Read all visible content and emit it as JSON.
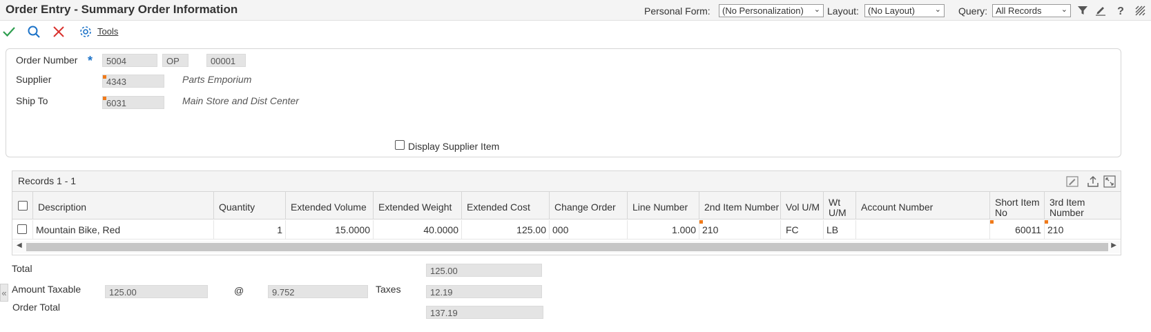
{
  "header": {
    "title": "Order Entry - Summary Order Information",
    "personal_form_label": "Personal Form:",
    "personal_form_value": "(No Personalization)",
    "layout_label": "Layout:",
    "layout_value": "(No Layout)",
    "query_label": "Query:",
    "query_value": "All Records",
    "icons": [
      "filter-icon",
      "edit-icon",
      "help-icon",
      "stripes-icon"
    ]
  },
  "toolbar": {
    "tools_label": "Tools",
    "icons": [
      "checkmark-icon",
      "search-icon",
      "close-icon",
      "gear-icon"
    ]
  },
  "form": {
    "order_number_label": "Order Number",
    "order_number": "5004",
    "order_type": "OP",
    "order_company": "00001",
    "supplier_label": "Supplier",
    "supplier": "4343",
    "supplier_name": "Parts Emporium",
    "ship_to_label": "Ship To",
    "ship_to": "6031",
    "ship_to_name": "Main Store and Dist Center",
    "display_supplier_item_label": "Display Supplier Item"
  },
  "grid": {
    "records_label": "Records 1 - 1",
    "columns": [
      "Description",
      "Quantity",
      "Extended Volume",
      "Extended Weight",
      "Extended Cost",
      "Change Order",
      "Line Number",
      "2nd Item Number",
      "Vol U/M",
      "Wt U/M",
      "Account Number",
      "Short Item No",
      "3rd Item Number"
    ],
    "rows": [
      {
        "description": "Mountain Bike, Red",
        "quantity": "1",
        "extended_volume": "15.0000",
        "extended_weight": "40.0000",
        "extended_cost": "125.00",
        "change_order": "000",
        "line_number": "1.000",
        "second_item_number": "210",
        "vol_um": "FC",
        "wt_um": "LB",
        "account_number": "",
        "short_item_no": "60011",
        "third_item_number": "210"
      }
    ]
  },
  "totals": {
    "total_label": "Total",
    "total": "125.00",
    "amount_taxable_label": "Amount Taxable",
    "amount_taxable": "125.00",
    "at_symbol": "@",
    "tax_rate": "9.752",
    "taxes_label": "Taxes",
    "taxes": "12.19",
    "order_total_label": "Order Total",
    "order_total": "137.19"
  },
  "colors": {
    "accent_blue": "#1d73c8",
    "confirm_green": "#2e9e4f",
    "cancel_red": "#d9312d",
    "required_flag": "#f07a1a"
  }
}
